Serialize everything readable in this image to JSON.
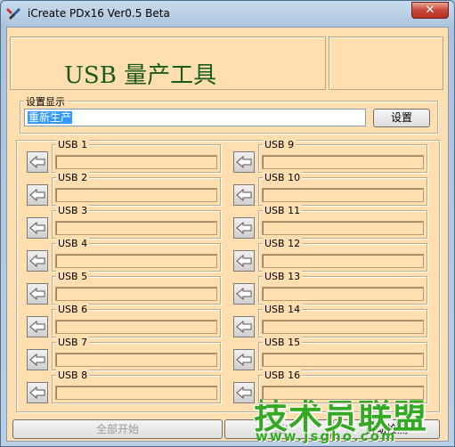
{
  "window": {
    "title": "iCreate PDx16 Ver0.5 Beta",
    "close_label": "✕"
  },
  "header": {
    "logo_text": "USB 量产工具"
  },
  "settings": {
    "group_label": "设置显示",
    "display_value": "重新生产",
    "button_label": "设置"
  },
  "ports_left": [
    {
      "label": "USB 1",
      "value": ""
    },
    {
      "label": "USB 2",
      "value": ""
    },
    {
      "label": "USB 3",
      "value": ""
    },
    {
      "label": "USB 4",
      "value": ""
    },
    {
      "label": "USB 5",
      "value": ""
    },
    {
      "label": "USB 6",
      "value": ""
    },
    {
      "label": "USB 7",
      "value": ""
    },
    {
      "label": "USB 8",
      "value": ""
    }
  ],
  "ports_right": [
    {
      "label": "USB 9",
      "value": ""
    },
    {
      "label": "USB 10",
      "value": ""
    },
    {
      "label": "USB 11",
      "value": ""
    },
    {
      "label": "USB 12",
      "value": ""
    },
    {
      "label": "USB 13",
      "value": ""
    },
    {
      "label": "USB 14",
      "value": ""
    },
    {
      "label": "USB 15",
      "value": ""
    },
    {
      "label": "USB 16",
      "value": ""
    }
  ],
  "footer": {
    "start_all_label": "全部开始",
    "middle_label": "退出",
    "right_label": "自动检测"
  },
  "watermark": {
    "title": "技术员联盟",
    "url": "www.jsgho.com"
  },
  "colors": {
    "client_bg": "#ffdfb0",
    "logo_text": "#1a5a1a",
    "watermark": "#33aa22",
    "selection": "#3399ff"
  }
}
